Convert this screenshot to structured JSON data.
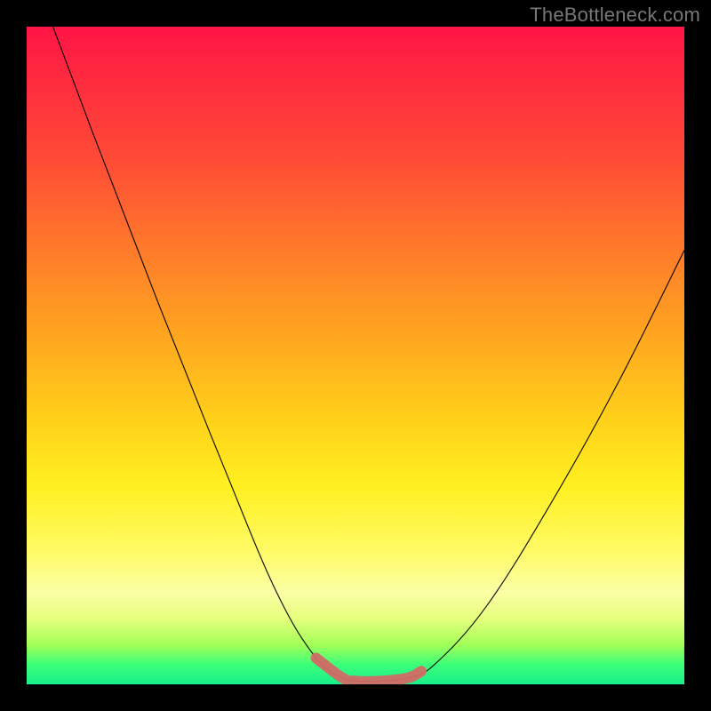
{
  "watermark": "TheBottleneck.com",
  "colors": {
    "frame": "#000000",
    "watermark": "#777777",
    "curve": "#000000",
    "highlight": "#d26a66",
    "gradient_stops": [
      "#ff1446",
      "#ff2b3f",
      "#ff4a36",
      "#ff7b2a",
      "#ffa91f",
      "#ffd21a",
      "#fff021",
      "#fffb68",
      "#fbffa6",
      "#e6ff7d",
      "#a2ff58",
      "#3cff7a",
      "#17f08b"
    ]
  },
  "chart_data": {
    "type": "line",
    "title": "",
    "xlabel": "",
    "ylabel": "",
    "xlim": [
      0,
      100
    ],
    "ylim": [
      0,
      100
    ],
    "grid": false,
    "series": [
      {
        "name": "curve",
        "x": [
          4,
          10,
          20,
          30,
          38,
          44,
          48,
          50,
          54,
          58,
          62,
          70,
          80,
          90,
          100
        ],
        "y": [
          100,
          84,
          58,
          33,
          14,
          4,
          1,
          0.5,
          0.5,
          1,
          3,
          12,
          28,
          46,
          66
        ]
      }
    ],
    "highlight_range_x": [
      44,
      60
    ],
    "annotations": []
  }
}
